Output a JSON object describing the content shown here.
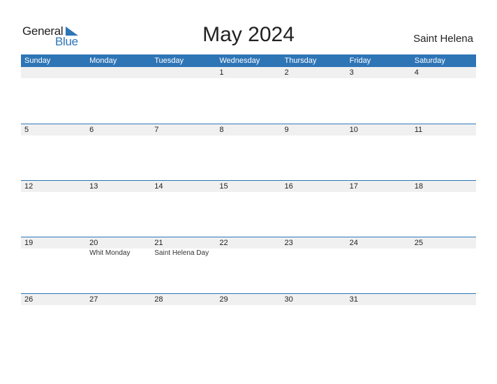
{
  "logo": {
    "general": "General",
    "blue": "Blue"
  },
  "title": "May 2024",
  "country": "Saint Helena",
  "colors": {
    "accent": "#2e75b6",
    "band": "#f0f0f0"
  },
  "days_of_week": [
    "Sunday",
    "Monday",
    "Tuesday",
    "Wednesday",
    "Thursday",
    "Friday",
    "Saturday"
  ],
  "weeks": [
    [
      {
        "day": ""
      },
      {
        "day": ""
      },
      {
        "day": ""
      },
      {
        "day": "1"
      },
      {
        "day": "2"
      },
      {
        "day": "3"
      },
      {
        "day": "4"
      }
    ],
    [
      {
        "day": "5"
      },
      {
        "day": "6"
      },
      {
        "day": "7"
      },
      {
        "day": "8"
      },
      {
        "day": "9"
      },
      {
        "day": "10"
      },
      {
        "day": "11"
      }
    ],
    [
      {
        "day": "12"
      },
      {
        "day": "13"
      },
      {
        "day": "14"
      },
      {
        "day": "15"
      },
      {
        "day": "16"
      },
      {
        "day": "17"
      },
      {
        "day": "18"
      }
    ],
    [
      {
        "day": "19"
      },
      {
        "day": "20",
        "event": "Whit Monday"
      },
      {
        "day": "21",
        "event": "Saint Helena Day"
      },
      {
        "day": "22"
      },
      {
        "day": "23"
      },
      {
        "day": "24"
      },
      {
        "day": "25"
      }
    ],
    [
      {
        "day": "26"
      },
      {
        "day": "27"
      },
      {
        "day": "28"
      },
      {
        "day": "29"
      },
      {
        "day": "30"
      },
      {
        "day": "31"
      },
      {
        "day": ""
      }
    ]
  ]
}
